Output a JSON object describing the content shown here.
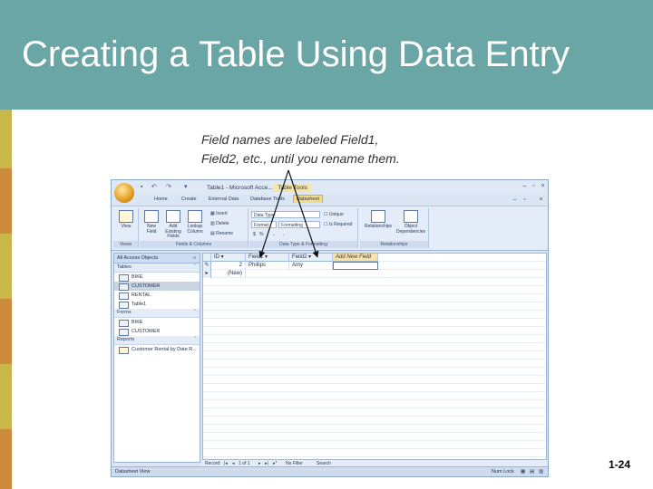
{
  "slide": {
    "title": "Creating a Table Using Data Entry",
    "annotation_line1": "Field names are labeled Field1,",
    "annotation_line2": "Field2, etc., until you rename them.",
    "page_number": "1-24",
    "colors": {
      "header": "#6aa6a6",
      "strip_yellow": "#c8b84a",
      "strip_orange": "#cd8a3a"
    }
  },
  "window": {
    "title": "Table1 - Microsoft Acce...",
    "context_tab": "Table Tools",
    "tabs": [
      "Home",
      "Create",
      "External Data",
      "Database Tools",
      "Datasheet"
    ],
    "active_tab": "Datasheet"
  },
  "ribbon": {
    "views_group": {
      "label": "Views",
      "view_button": "View"
    },
    "fields_group": {
      "label": "Fields & Columns",
      "new_field": "New Field",
      "add_existing": "Add Existing Fields",
      "lookup_column": "Lookup Column",
      "insert": "Insert",
      "delete": "Delete",
      "rename": "Rename"
    },
    "datatype_group": {
      "label": "Data Type & Formatting",
      "data_type": "Data Type:",
      "format": "Format:",
      "formatting": "Formatting",
      "unique": "Unique",
      "is_required": "Is Required"
    },
    "relationships_group": {
      "label": "Relationships",
      "relationships": "Relationships",
      "object_dependencies": "Object Dependencies"
    }
  },
  "nav_pane": {
    "header": "All Access Objects",
    "sections": [
      {
        "name": "Tables",
        "items": [
          "BIKE",
          "CUSTOMER",
          "RENTAL",
          "Table1"
        ]
      },
      {
        "name": "Forms",
        "items": [
          "BIKE",
          "CUSTOMER"
        ]
      },
      {
        "name": "Reports",
        "items": [
          "Customer Rental by Date R..."
        ]
      }
    ],
    "selected_item": "CUSTOMER"
  },
  "datasheet": {
    "columns": [
      "ID",
      "Field1",
      "Field2",
      "Add New Field"
    ],
    "rows": [
      {
        "id": "2",
        "field1": "Phillips",
        "field2": "Amy"
      }
    ],
    "new_row_label": "(New)",
    "record_nav": {
      "label": "Record:",
      "position": "1 of 1",
      "filter": "No Filter",
      "search": "Search"
    }
  },
  "status_bar": {
    "left": "Datasheet View",
    "right": "Num Lock"
  }
}
